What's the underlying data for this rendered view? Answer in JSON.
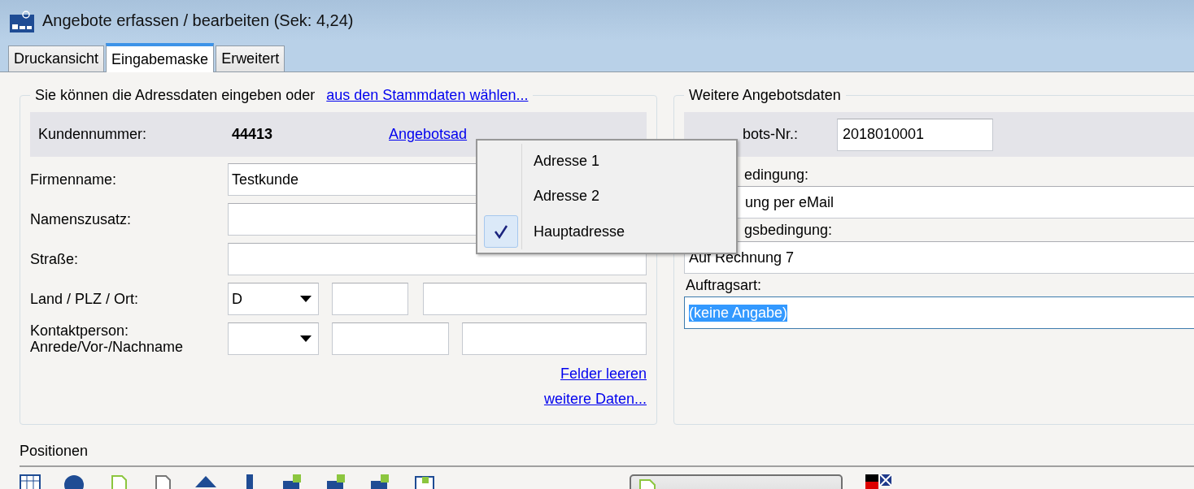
{
  "window": {
    "title": "Angebote erfassen / bearbeiten (Sek: 4,24)"
  },
  "tabs": [
    {
      "label": "Druckansicht",
      "selected": false
    },
    {
      "label": "Eingabemaske",
      "selected": true
    },
    {
      "label": "Erweitert",
      "selected": false
    }
  ],
  "address_panel": {
    "intro": "Sie können die Adressdaten eingeben oder",
    "intro_link": "aus den Stammdaten wählen...",
    "customer_number_label": "Kundennummer:",
    "customer_number": "44413",
    "address_link": "Angebotsad",
    "fields": [
      {
        "kind": "text",
        "label": [
          "Firmenname:"
        ],
        "value": "Testkunde"
      },
      {
        "kind": "text",
        "label": [
          "Namenszusatz:"
        ]
      },
      {
        "kind": "text",
        "label": [
          "Straße:"
        ]
      },
      {
        "kind": "location",
        "label": [
          "Land / PLZ / Ort:"
        ],
        "country": "D"
      },
      {
        "kind": "contact",
        "label": [
          "Kontaktperson:",
          "Anrede/Vor-/Nachname"
        ]
      }
    ],
    "links": [
      "Felder leeren",
      "weitere Daten..."
    ]
  },
  "offer_panel": {
    "title": "Weitere Angebotsdaten",
    "number_label": "bots-Nr.:",
    "number": "2018010001",
    "fields": [
      {
        "label": "edingung:",
        "value": "ung per eMail",
        "focused": false
      },
      {
        "label": "gsbedingung:",
        "value": "Auf Rechnung 7",
        "focused": false
      },
      {
        "label": "Auftragsart:",
        "value": "(keine Angabe)",
        "focused": true
      }
    ]
  },
  "address_menu": {
    "items": [
      {
        "label": "Adresse 1",
        "checked": false
      },
      {
        "label": "Adresse 2",
        "checked": false
      },
      {
        "label": "Hauptadresse",
        "checked": true
      }
    ]
  },
  "positions": {
    "title": "Positionen"
  }
}
